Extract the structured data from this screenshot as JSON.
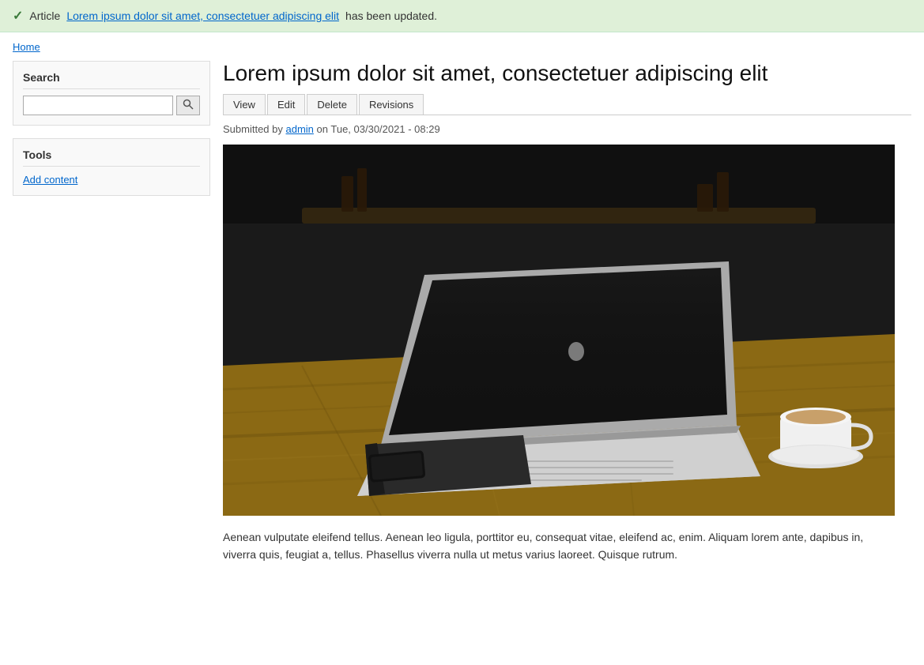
{
  "banner": {
    "message_prefix": "Article",
    "article_link_text": "Lorem ipsum dolor sit amet, consectetuer adipiscing elit",
    "message_suffix": "has been updated.",
    "check_symbol": "✓"
  },
  "breadcrumb": {
    "home_label": "Home",
    "home_url": "#"
  },
  "sidebar": {
    "search_heading": "Search",
    "search_placeholder": "",
    "search_button_label": "🔍",
    "tools_heading": "Tools",
    "add_content_label": "Add content"
  },
  "article": {
    "title": "Lorem ipsum dolor sit amet, consectetuer adipiscing elit",
    "tabs": [
      {
        "label": "View",
        "active": true
      },
      {
        "label": "Edit",
        "active": false
      },
      {
        "label": "Delete",
        "active": false
      },
      {
        "label": "Revisions",
        "active": false
      }
    ],
    "submitted_prefix": "Submitted by",
    "author": "admin",
    "submitted_suffix": "on Tue, 03/30/2021 - 08:29",
    "body": "Aenean vulputate eleifend tellus. Aenean leo ligula, porttitor eu, consequat vitae, eleifend ac, enim. Aliquam lorem ante, dapibus in, viverra quis, feugiat a, tellus. Phasellus viverra nulla ut metus varius laoreet. Quisque rutrum."
  },
  "colors": {
    "success_bg": "#dff0d8",
    "link_color": "#0066cc",
    "accent_green": "#3a7a3a"
  }
}
